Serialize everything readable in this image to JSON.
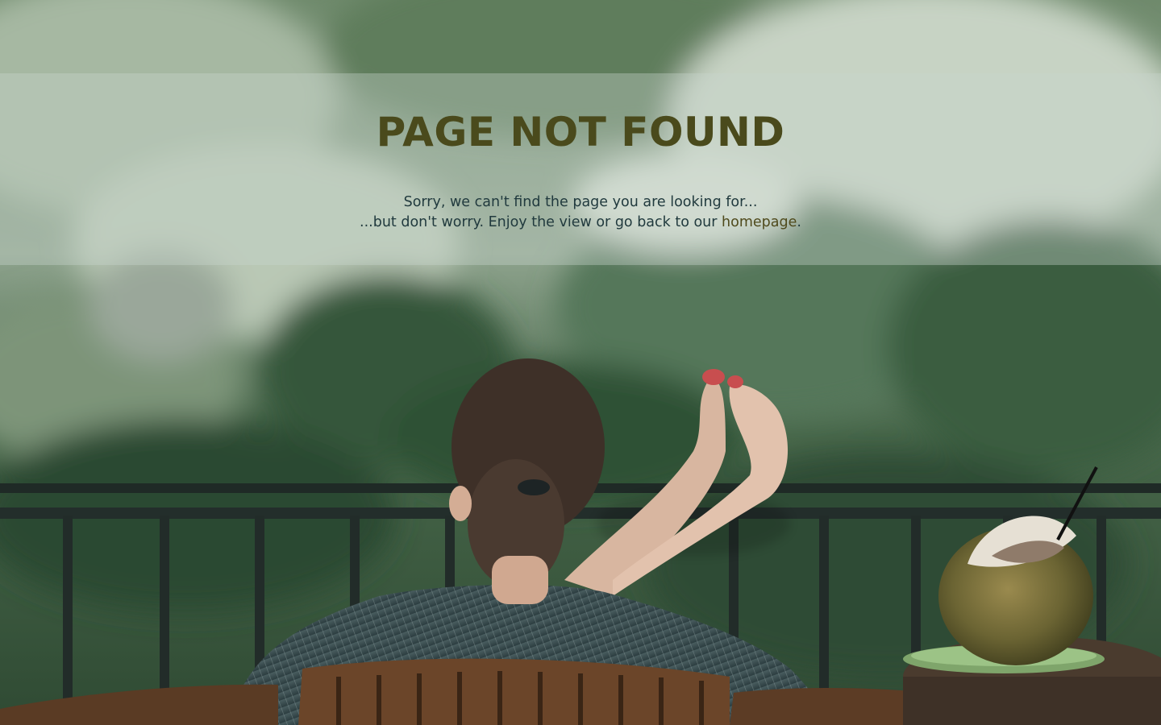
{
  "error_page": {
    "title": "PAGE NOT FOUND",
    "message_line1": "Sorry, we can't find the page you are looking for...",
    "message_line2_prefix": "...but don't worry. Enjoy the view or go back to our ",
    "homepage_link_label": "homepage",
    "message_line2_suffix": "."
  },
  "colors": {
    "title": "#4a4a1c",
    "body_text": "#213a3e",
    "link": "#4f4a1c",
    "banner_overlay": "rgba(200,212,204,0.38)"
  }
}
